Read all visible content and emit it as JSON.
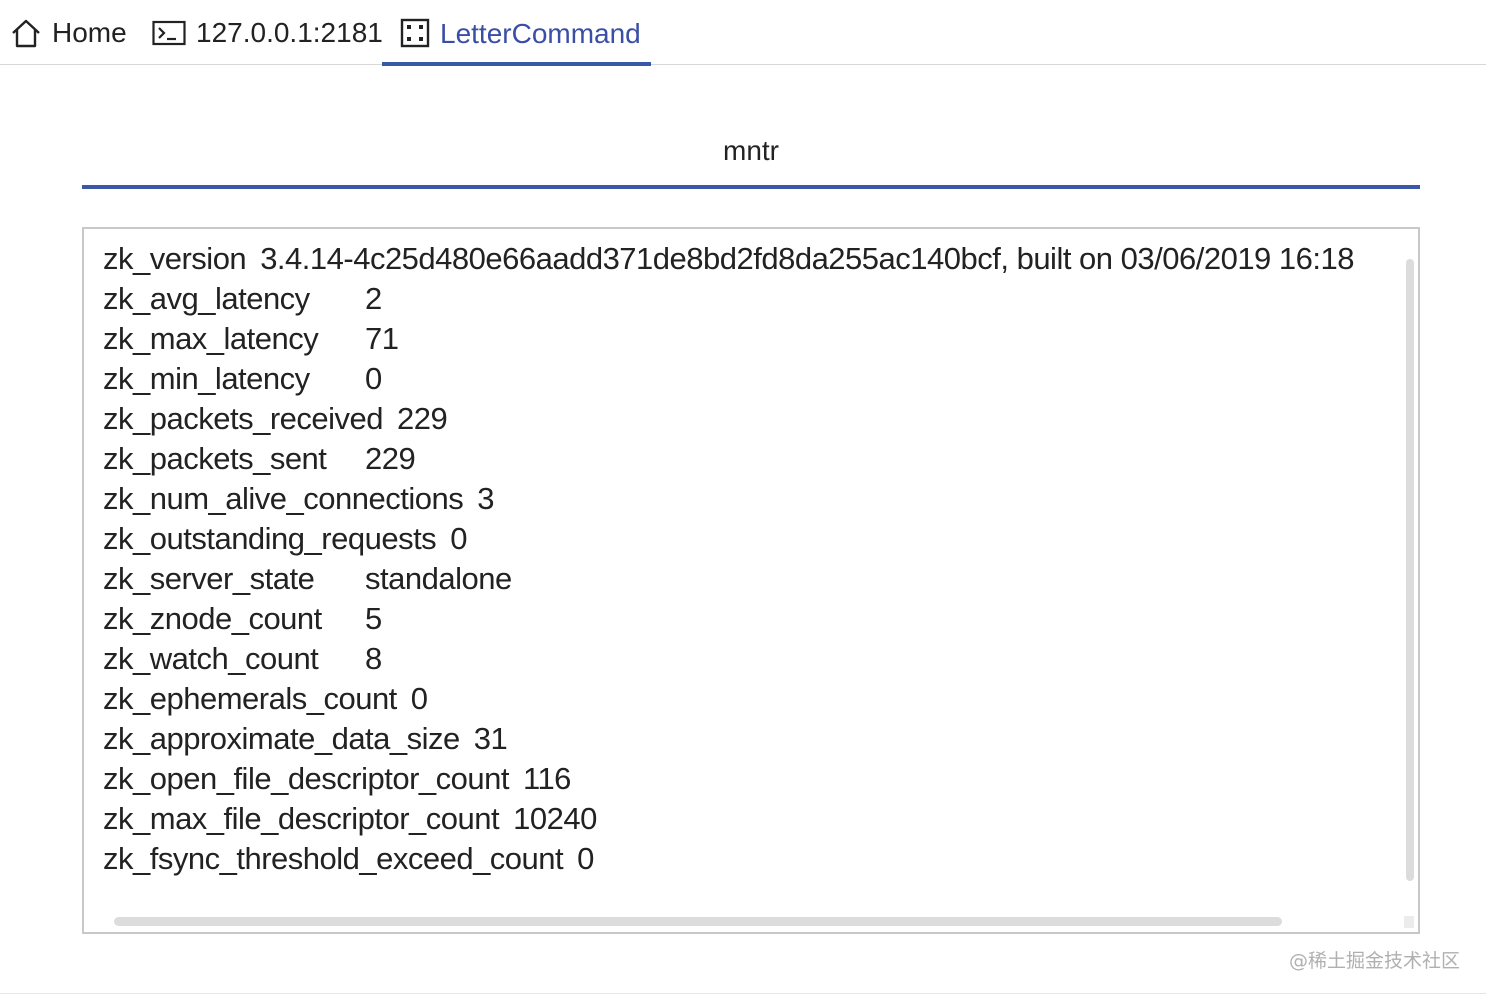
{
  "tabs": [
    {
      "label": "Home",
      "icon": "home-icon"
    },
    {
      "label": "127.0.0.1:2181",
      "icon": "terminal-icon"
    },
    {
      "label": "LetterCommand",
      "icon": "dice-icon",
      "active": true
    }
  ],
  "accent_color": "#3a58a8",
  "command": {
    "title": "mntr"
  },
  "output": {
    "lines": [
      {
        "key": "zk_version",
        "value": "3.4.14-4c25d480e66aadd371de8bd2fd8da255ac140bcf, built on 03/06/2019 16:18"
      },
      {
        "key": "zk_avg_latency",
        "value": "2"
      },
      {
        "key": "zk_max_latency",
        "value": "71"
      },
      {
        "key": "zk_min_latency",
        "value": "0"
      },
      {
        "key": "zk_packets_received",
        "value": "229"
      },
      {
        "key": "zk_packets_sent",
        "value": "229"
      },
      {
        "key": "zk_num_alive_connections",
        "value": "3"
      },
      {
        "key": "zk_outstanding_requests",
        "value": "0"
      },
      {
        "key": "zk_server_state",
        "value": "standalone"
      },
      {
        "key": "zk_znode_count",
        "value": "5"
      },
      {
        "key": "zk_watch_count",
        "value": "8"
      },
      {
        "key": "zk_ephemerals_count",
        "value": "0"
      },
      {
        "key": "zk_approximate_data_size",
        "value": "31"
      },
      {
        "key": "zk_open_file_descriptor_count",
        "value": "116"
      },
      {
        "key": "zk_max_file_descriptor_count",
        "value": "10240"
      },
      {
        "key": "zk_fsync_threshold_exceed_count",
        "value": "0"
      }
    ]
  },
  "watermark": "@稀土掘金技术社区"
}
